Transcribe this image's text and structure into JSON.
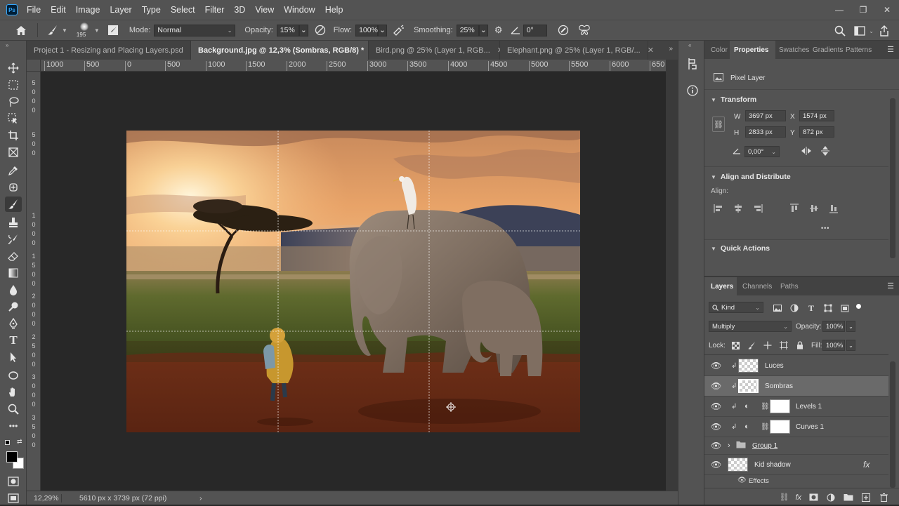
{
  "app": {
    "logo": "Ps"
  },
  "menu": [
    "File",
    "Edit",
    "Image",
    "Layer",
    "Type",
    "Select",
    "Filter",
    "3D",
    "View",
    "Window",
    "Help"
  ],
  "window_controls": {
    "minimize": "—",
    "restore": "❐",
    "close": "✕"
  },
  "options": {
    "brush_size": "195",
    "mode_label": "Mode:",
    "mode_value": "Normal",
    "opacity_label": "Opacity:",
    "opacity_value": "15%",
    "flow_label": "Flow:",
    "flow_value": "100%",
    "smoothing_label": "Smoothing:",
    "smoothing_value": "25%",
    "angle_value": "0°"
  },
  "tabs": [
    {
      "label": "Project 1 - Resizing and Placing Layers.psd",
      "active": false
    },
    {
      "label": "Background.jpg @ 12,3% (Sombras, RGB/8) *",
      "active": true
    },
    {
      "label": "Bird.png @ 25% (Layer 1, RGB...",
      "active": false
    },
    {
      "label": "Elephant.png @ 25% (Layer 1, RGB/...",
      "active": false
    }
  ],
  "ruler": {
    "top": [
      "1000",
      "500",
      "0",
      "500",
      "1000",
      "1500",
      "2000",
      "2500",
      "3000",
      "3500",
      "4000",
      "4500",
      "5000",
      "5500",
      "6000",
      "650"
    ],
    "left": [
      "5",
      "0",
      "0",
      "0",
      "5",
      "0",
      "0",
      "1",
      "0",
      "0",
      "0",
      "1",
      "5",
      "0",
      "0",
      "2",
      "0",
      "0",
      "0",
      "2",
      "5",
      "0",
      "0",
      "3",
      "0",
      "0",
      "0",
      "3",
      "5",
      "0",
      "0"
    ]
  },
  "status": {
    "zoom": "12,29%",
    "doc_size": "5610 px x 3739 px (72 ppi)",
    "arrow": "›"
  },
  "properties": {
    "tabs": [
      "Color",
      "Properties",
      "Swatches",
      "Gradients",
      "Patterns"
    ],
    "active_tab": "Properties",
    "pixel_layer": "Pixel Layer",
    "transform_title": "Transform",
    "w_label": "W",
    "w_value": "3697 px",
    "x_label": "X",
    "x_value": "1574 px",
    "h_label": "H",
    "h_value": "2833 px",
    "y_label": "Y",
    "y_value": "872 px",
    "angle_value": "0,00°",
    "align_title": "Align and Distribute",
    "align_label": "Align:",
    "more": "•••",
    "quick_title": "Quick Actions"
  },
  "layers_panel": {
    "tabs": [
      "Layers",
      "Channels",
      "Paths"
    ],
    "active_tab": "Layers",
    "filter_kind": "Kind",
    "blend_mode": "Multiply",
    "opacity_label": "Opacity:",
    "opacity_value": "100%",
    "lock_label": "Lock:",
    "fill_label": "Fill:",
    "fill_value": "100%",
    "layers": [
      {
        "name": "Luces",
        "type": "pixel",
        "clipped": true,
        "selected": false
      },
      {
        "name": "Sombras",
        "type": "pixel",
        "clipped": true,
        "selected": true
      },
      {
        "name": "Levels 1",
        "type": "adjustment",
        "clipped": true,
        "selected": false
      },
      {
        "name": "Curves 1",
        "type": "adjustment",
        "clipped": true,
        "selected": false
      },
      {
        "name": "Group 1",
        "type": "group",
        "clipped": false,
        "selected": false
      },
      {
        "name": "Kid shadow",
        "type": "pixel",
        "clipped": false,
        "selected": false,
        "fx": "fx"
      }
    ],
    "effects_label": "Effects"
  },
  "colors": {
    "accent": "#31a8ff",
    "panel": "#535353",
    "dark": "#424242",
    "canvas_bg": "#282828"
  }
}
